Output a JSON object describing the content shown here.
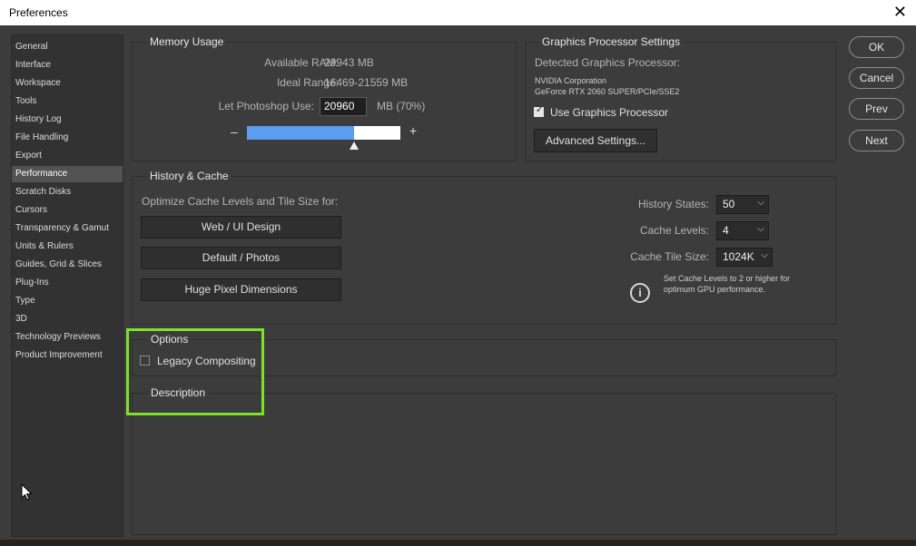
{
  "window": {
    "title": "Preferences",
    "close_glyph": "✕"
  },
  "sidebar": {
    "items": [
      {
        "label": "General"
      },
      {
        "label": "Interface"
      },
      {
        "label": "Workspace"
      },
      {
        "label": "Tools"
      },
      {
        "label": "History Log"
      },
      {
        "label": "File Handling"
      },
      {
        "label": "Export"
      },
      {
        "label": "Performance",
        "active": true
      },
      {
        "label": "Scratch Disks"
      },
      {
        "label": "Cursors"
      },
      {
        "label": "Transparency & Gamut"
      },
      {
        "label": "Units & Rulers"
      },
      {
        "label": "Guides, Grid & Slices"
      },
      {
        "label": "Plug-Ins"
      },
      {
        "label": "Type"
      },
      {
        "label": "3D"
      },
      {
        "label": "Technology Previews"
      },
      {
        "label": "Product Improvement"
      }
    ]
  },
  "memory": {
    "title": "Memory Usage",
    "available_label": "Available RAM:",
    "available_value": "29943 MB",
    "ideal_label": "Ideal Range:",
    "ideal_value": "16469-21559 MB",
    "use_label": "Let Photoshop Use:",
    "use_value": "20960",
    "use_suffix": "MB (70%)",
    "minus": "–",
    "plus": "+",
    "slider_fraction": 0.7,
    "accent_color": "#5b9ef0"
  },
  "gpu": {
    "title": "Graphics Processor Settings",
    "detected_label": "Detected Graphics Processor:",
    "vendor": "NVIDIA Corporation",
    "model": "GeForce RTX 2060 SUPER/PCIe/SSE2",
    "use_gpu_label": "Use Graphics Processor",
    "use_gpu_checked": true,
    "advanced_button": "Advanced Settings..."
  },
  "history": {
    "title": "History & Cache",
    "optimize_label": "Optimize Cache Levels and Tile Size for:",
    "buttons": [
      "Web / UI Design",
      "Default / Photos",
      "Huge Pixel Dimensions"
    ],
    "states_label": "History States:",
    "states_value": "50",
    "levels_label": "Cache Levels:",
    "levels_value": "4",
    "tile_label": "Cache Tile Size:",
    "tile_value": "1024K",
    "info_icon": "info-icon",
    "info_line1": "Set Cache Levels to 2 or higher for",
    "info_line2": "optimum GPU performance."
  },
  "options": {
    "title": "Options",
    "legacy_label": "Legacy Compositing",
    "legacy_checked": false
  },
  "description": {
    "title": "Description"
  },
  "dialog_buttons": {
    "ok": "OK",
    "cancel": "Cancel",
    "prev": "Prev",
    "next": "Next"
  },
  "highlight_color": "#7ee22a"
}
